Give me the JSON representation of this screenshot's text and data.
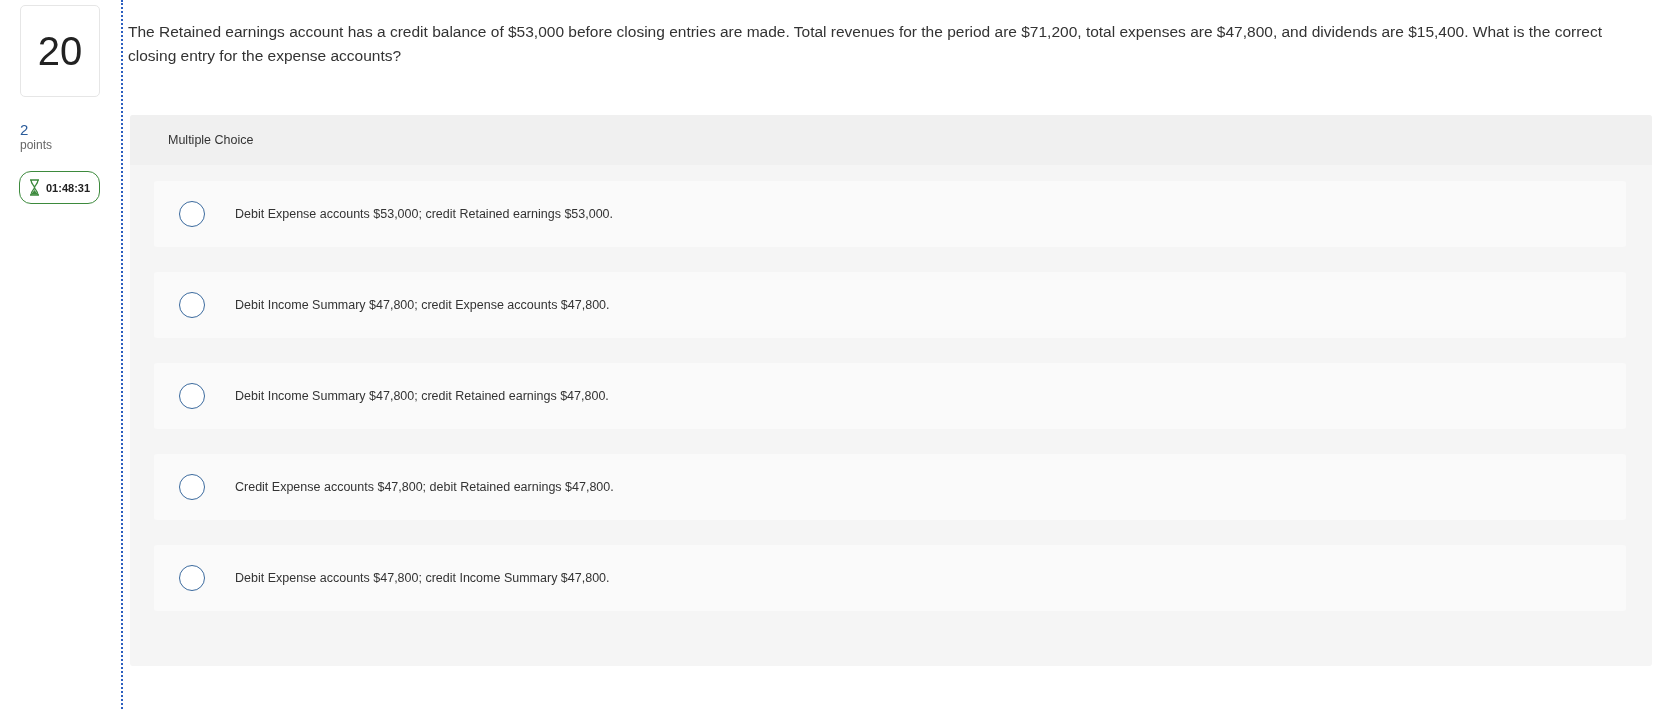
{
  "question": {
    "number": "20",
    "points_value": "2",
    "points_label": "points",
    "timer": "01:48:31",
    "text": "The Retained earnings account has a credit balance of $53,000 before closing entries are made. Total revenues for the period are $71,200, total expenses are $47,800, and dividends are $15,400. What is the correct closing entry for the expense accounts?"
  },
  "answer_panel": {
    "type_label": "Multiple Choice",
    "options": [
      {
        "text": "Debit Expense accounts $53,000; credit Retained earnings $53,000.",
        "selected": false
      },
      {
        "text": "Debit Income Summary $47,800; credit Expense accounts $47,800.",
        "selected": false
      },
      {
        "text": "Debit Income Summary $47,800; credit Retained earnings $47,800.",
        "selected": false
      },
      {
        "text": "Credit Expense accounts $47,800; debit Retained earnings $47,800.",
        "selected": false
      },
      {
        "text": "Debit Expense accounts $47,800; credit Income Summary $47,800.",
        "selected": false
      }
    ]
  }
}
